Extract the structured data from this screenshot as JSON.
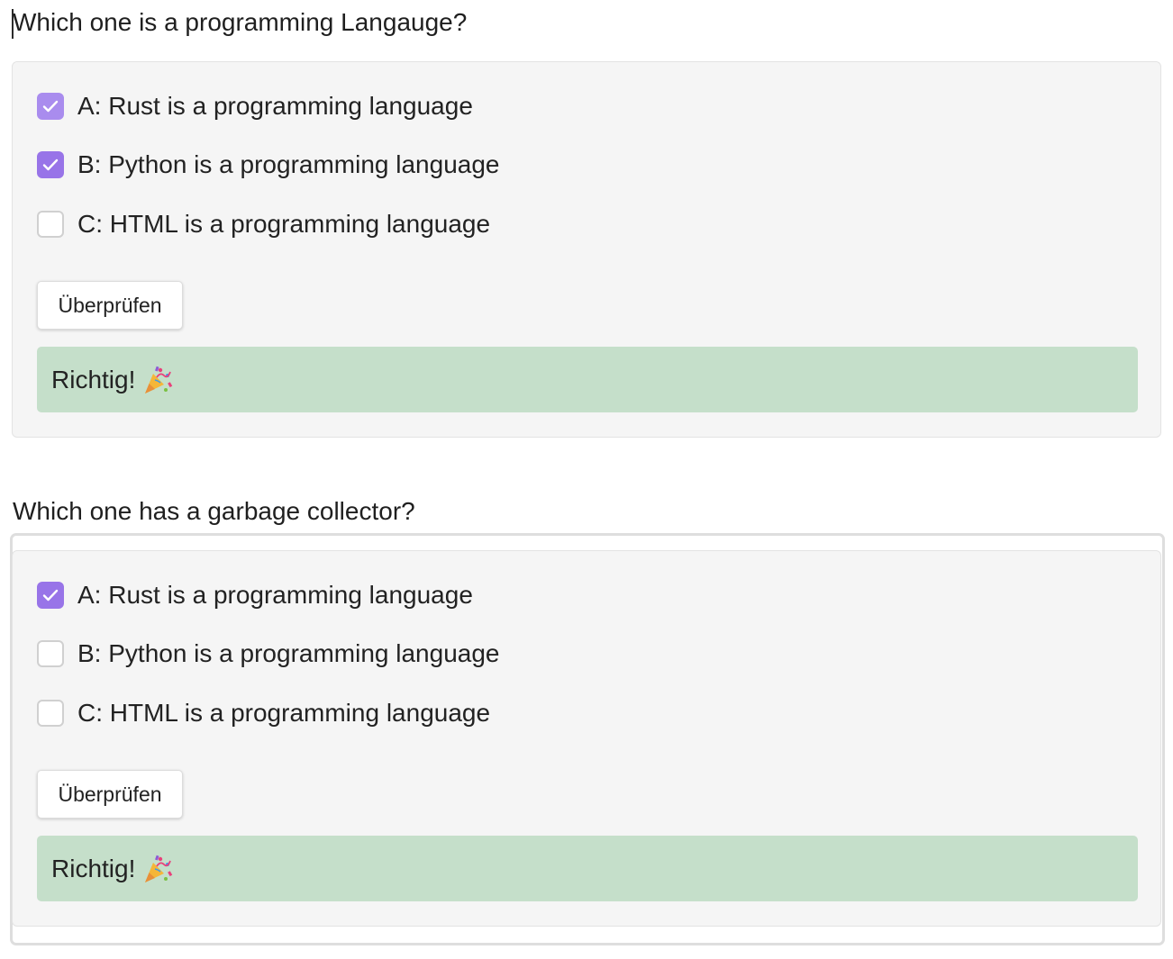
{
  "quizzes": [
    {
      "question": "Which one is a programming Langauge?",
      "options": [
        {
          "label": "A: Rust is a programming language",
          "checked": true
        },
        {
          "label": "B: Python is a programming language",
          "checked": true
        },
        {
          "label": "C: HTML is a programming language",
          "checked": false
        }
      ],
      "check_button": "Überprüfen",
      "feedback": "Richtig!"
    },
    {
      "question": "Which one has a garbage collector?",
      "options": [
        {
          "label": "A: Rust is a programming language",
          "checked": true
        },
        {
          "label": "B: Python is a programming language",
          "checked": false
        },
        {
          "label": "C: HTML is a programming language",
          "checked": false
        }
      ],
      "check_button": "Überprüfen",
      "feedback": "Richtig!"
    }
  ],
  "icons": {
    "checkmark": "checkmark-icon",
    "feedback": "party-popper-icon",
    "code_view": "code-icon"
  },
  "colors": {
    "checkbox_checked": "#9874e8",
    "feedback_success_bg": "#c5dfca",
    "card_bg": "#f5f5f5"
  }
}
